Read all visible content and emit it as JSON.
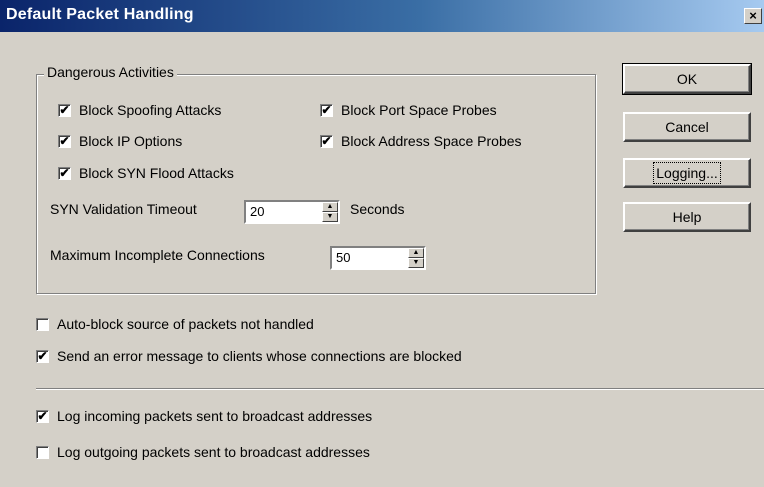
{
  "window": {
    "title": "Default Packet Handling",
    "close_glyph": "×"
  },
  "group": {
    "legend": "Dangerous Activities",
    "checkboxes": [
      {
        "label": "Block Spoofing Attacks",
        "checked": true
      },
      {
        "label": "Block Port Space Probes",
        "checked": true
      },
      {
        "label": "Block IP Options",
        "checked": true
      },
      {
        "label": "Block Address Space Probes",
        "checked": true
      },
      {
        "label": "Block SYN Flood Attacks",
        "checked": true
      }
    ],
    "syn_timeout": {
      "label": "SYN Validation Timeout",
      "value": "20",
      "unit": "Seconds"
    },
    "max_incomplete": {
      "label": "Maximum Incomplete Connections",
      "value": "50"
    }
  },
  "options": [
    {
      "label": "Auto-block source of packets not handled",
      "checked": false
    },
    {
      "label": "Send an error message to clients whose connections are blocked",
      "checked": true
    }
  ],
  "logging": [
    {
      "label": "Log incoming packets sent to broadcast addresses",
      "checked": true
    },
    {
      "label": "Log outgoing packets sent to broadcast addresses",
      "checked": false
    }
  ],
  "buttons": {
    "ok": "OK",
    "cancel": "Cancel",
    "logging": "Logging...",
    "help": "Help"
  }
}
